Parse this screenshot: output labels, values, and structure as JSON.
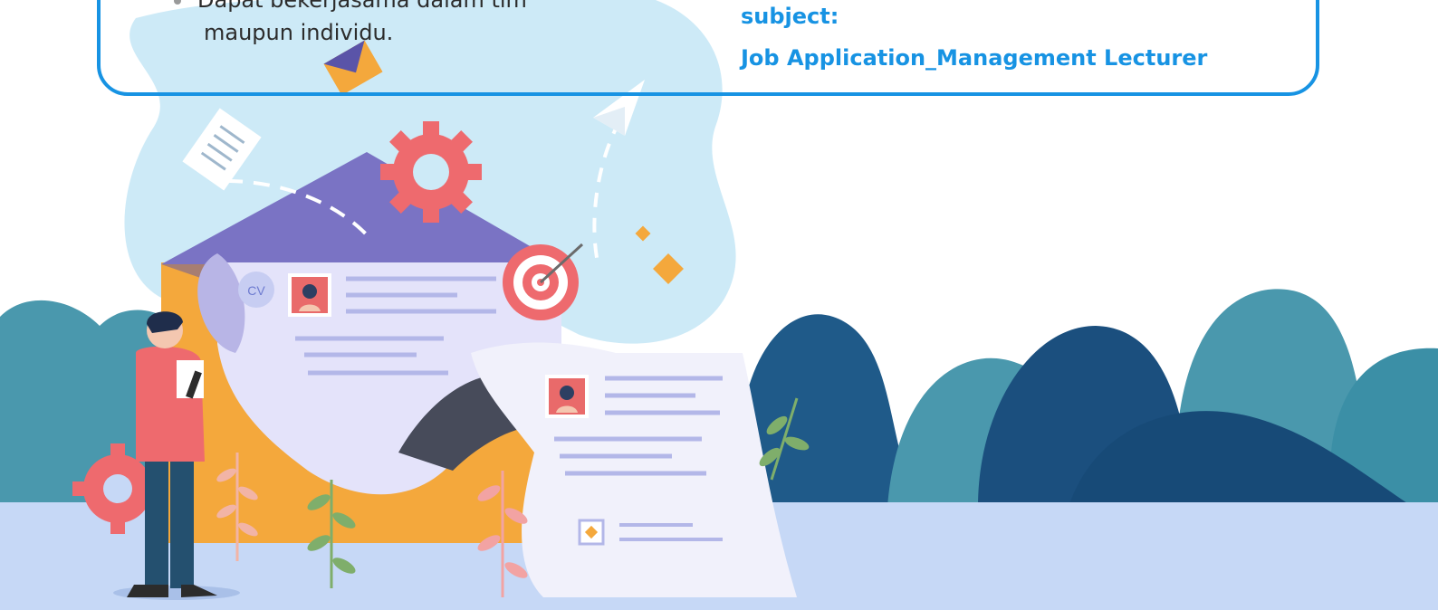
{
  "requirements": {
    "bullet_text": "Dapat bekerjasama dalam tim",
    "continuation": "maupun individu."
  },
  "email": {
    "subject_label": "subject:",
    "subject_value": "Job Application_Management Lecturer"
  },
  "illustration": {
    "cv_badge": "CV",
    "colors": {
      "card_border": "#1793e3",
      "accent_text": "#1793e3",
      "blob": "#cdeaf7",
      "ground": "#c6d8f6",
      "envelope": "#f4a83c",
      "envelope_flap": "#7a73c4",
      "paper": "#e4e3fa",
      "gear": "#ee6a6e",
      "hills_dark": "#1b4f7e",
      "hills_teal": "#4a98ad"
    }
  }
}
